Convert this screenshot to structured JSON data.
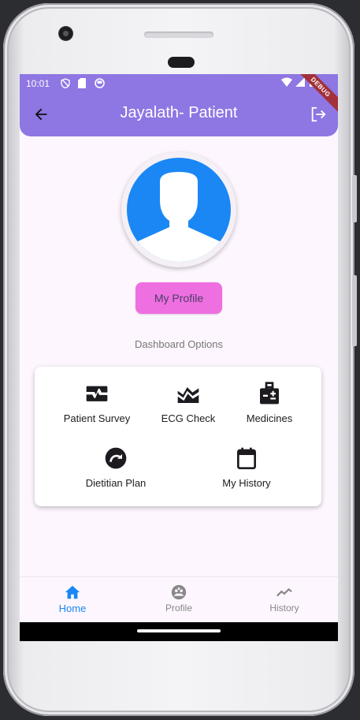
{
  "status_bar": {
    "time": "10:01",
    "debug_banner": "DEBUG"
  },
  "app_bar": {
    "title": "Jayalath- Patient"
  },
  "profile": {
    "button_label": "My Profile"
  },
  "dashboard": {
    "section_label": "Dashboard Options",
    "options": [
      {
        "label": "Patient Survey",
        "icon": "monitor-heart-icon"
      },
      {
        "label": "ECG Check",
        "icon": "ecg-icon"
      },
      {
        "label": "Medicines",
        "icon": "medical-kit-icon"
      },
      {
        "label": "Dietitian Plan",
        "icon": "redo-circle-icon"
      },
      {
        "label": "My History",
        "icon": "calendar-icon"
      }
    ]
  },
  "bottom_nav": {
    "active": "Home",
    "items": [
      {
        "label": "Home",
        "icon": "home-icon"
      },
      {
        "label": "Profile",
        "icon": "group-icon"
      },
      {
        "label": "History",
        "icon": "trending-icon"
      }
    ]
  },
  "colors": {
    "app_bar": "#8e76e3",
    "profile_button": "#ee6fe0",
    "avatar_bg": "#1a87f5",
    "active_nav": "#1a87f5",
    "inactive_nav": "#888888"
  }
}
